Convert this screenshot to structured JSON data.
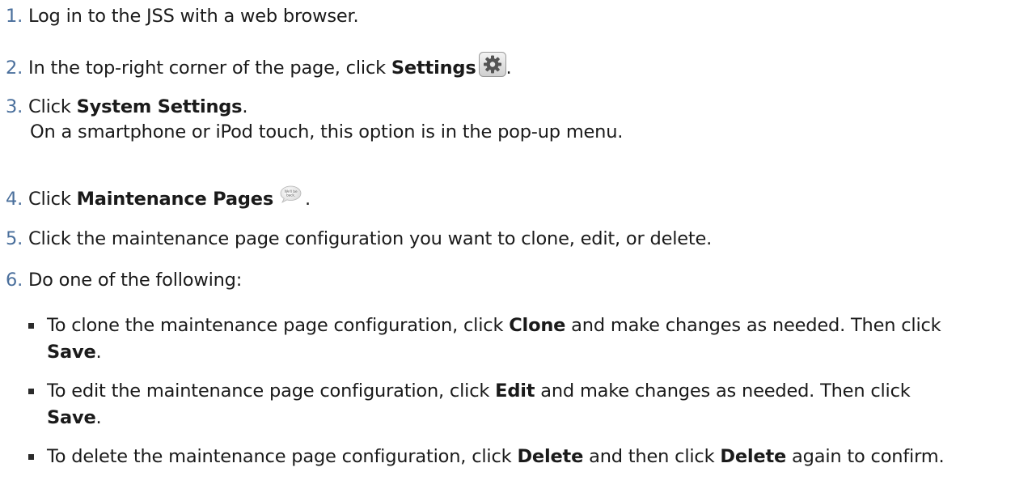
{
  "steps": [
    {
      "num": "1.",
      "text": "Log in to the JSS with a web browser."
    },
    {
      "num": "2.",
      "pre": "In the top-right corner of the page, click ",
      "bold": "Settings",
      "post": ".",
      "icon": "gear-icon"
    },
    {
      "num": "3.",
      "pre": "Click ",
      "bold": "System Settings",
      "post": ".",
      "note": "On a smartphone or iPod touch, this option is in the pop-up menu."
    },
    {
      "num": "4.",
      "pre": "Click ",
      "bold": "Maintenance Pages",
      "post": ".",
      "icon": "speech-bubble-icon",
      "icon_text": [
        "We'll be",
        "back."
      ]
    },
    {
      "num": "5.",
      "text": "Click the maintenance page configuration you want to clone, edit, or delete."
    },
    {
      "num": "6.",
      "text": "Do one of the following:"
    }
  ],
  "bullets": [
    {
      "pre": "To clone the maintenance page configuration, click ",
      "bold1": "Clone",
      "mid": " and make changes as needed. Then click",
      "bold2": "Save",
      "post": "."
    },
    {
      "pre": "To edit the maintenance page configuration, click ",
      "bold1": "Edit",
      "mid": " and make changes as needed. Then click",
      "bold2": "Save",
      "post": "."
    },
    {
      "pre": "To delete the maintenance page configuration, click ",
      "bold1": "Delete",
      "mid": " and then click ",
      "bold2": "Delete",
      "post": " again to confirm."
    }
  ],
  "colors": {
    "step_number": "#4a6f9c",
    "text": "#1a1a1a"
  }
}
